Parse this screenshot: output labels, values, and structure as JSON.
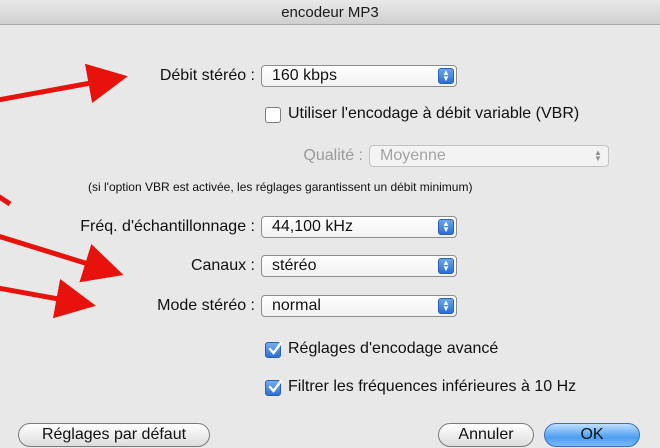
{
  "window": {
    "title": "encodeur MP3"
  },
  "bitrate": {
    "label": "Débit stéréo :",
    "value": "160 kbps"
  },
  "vbr": {
    "label": "Utiliser l'encodage à débit variable (VBR)",
    "checked": false
  },
  "quality": {
    "label": "Qualité :",
    "value": "Moyenne",
    "enabled": false
  },
  "vbr_note": "(si l'option VBR est activée, les réglages garantissent un débit minimum)",
  "sample_rate": {
    "label": "Fréq. d'échantillonnage :",
    "value": "44,100 kHz"
  },
  "channels": {
    "label": "Canaux :",
    "value": "stéréo"
  },
  "stereo_mode": {
    "label": "Mode stéréo :",
    "value": "normal"
  },
  "advanced": {
    "label": "Réglages d'encodage avancé",
    "checked": true
  },
  "filter": {
    "label": "Filtrer les fréquences inférieures à 10 Hz",
    "checked": true
  },
  "buttons": {
    "defaults": "Réglages par défaut",
    "cancel": "Annuler",
    "ok": "OK"
  },
  "colors": {
    "annotation_arrow": "#e8120c",
    "accent": "#2d6fd1"
  }
}
